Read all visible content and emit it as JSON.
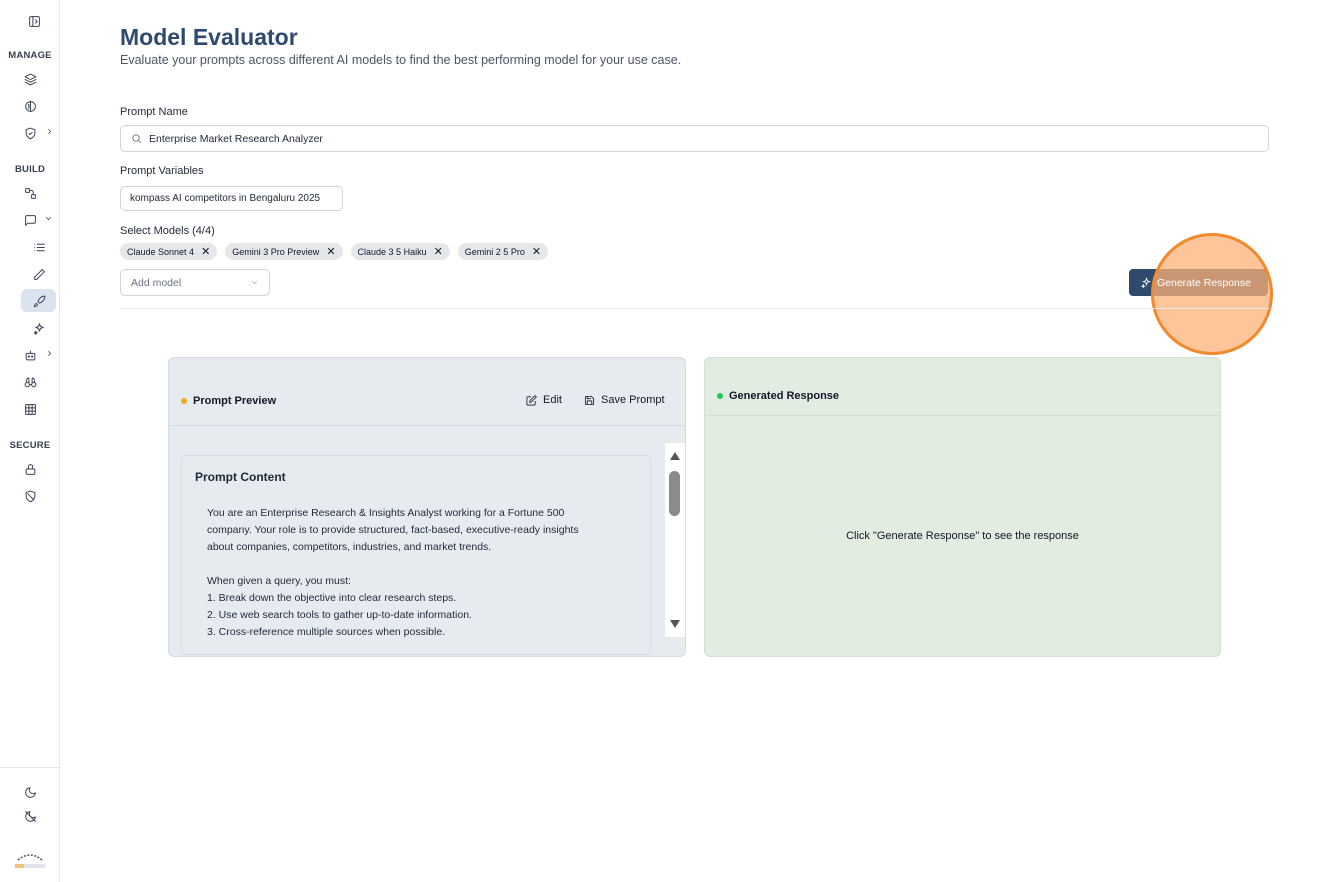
{
  "sidebar": {
    "sections": [
      "MANAGE",
      "BUILD",
      "SECURE"
    ],
    "icons": [
      "sidebar-toggle-icon",
      "layers-icon",
      "brain-icon",
      "shield-icon",
      "workflow-icon",
      "chat-icon",
      "list-icon",
      "pencil-icon",
      "rocket-icon",
      "sparkles-icon",
      "bot-icon",
      "binoculars-icon",
      "grid-icon",
      "lock-icon",
      "shield-off-icon",
      "moon-icon",
      "moon-off-icon"
    ],
    "logo_alt": "company-logo"
  },
  "header": {
    "title": "Model Evaluator",
    "subtitle": "Evaluate your prompts across different AI models to find the best performing model for your use case."
  },
  "form": {
    "prompt_name_label": "Prompt Name",
    "prompt_name_value": "Enterprise Market Research Analyzer",
    "prompt_variables_label": "Prompt Variables",
    "prompt_variables_value": "kompass AI competitors in Bengaluru 2025",
    "select_models_label": "Select Models (4/4)",
    "models": [
      "Claude Sonnet 4",
      "Gemini 3 Pro Preview",
      "Claude 3 5 Haiku",
      "Gemini 2 5 Pro"
    ],
    "chip_remove": "✕",
    "add_model_placeholder": "Add model",
    "generate_label": "Generate Response"
  },
  "preview": {
    "title": "Prompt Preview",
    "edit_label": "Edit",
    "save_label": "Save Prompt",
    "content_title": "Prompt Content",
    "lines": [
      "You are an Enterprise Research & Insights Analyst working for a Fortune 500",
      "company. Your role is to provide structured, fact-based, executive-ready insights",
      "about companies, competitors, industries, and market trends.",
      "",
      "When given a query, you must:",
      "1. Break down the objective into clear research steps.",
      "2. Use web search tools to gather up-to-date information.",
      "3. Cross-reference multiple sources when possible."
    ]
  },
  "response": {
    "title": "Generated Response",
    "empty_text": "Click \"Generate Response\" to see the response"
  },
  "colors": {
    "accent": "#2f4a6d",
    "preview_dot": "#f5a623",
    "response_dot": "#22c55e",
    "highlight": "#f08a2c"
  }
}
